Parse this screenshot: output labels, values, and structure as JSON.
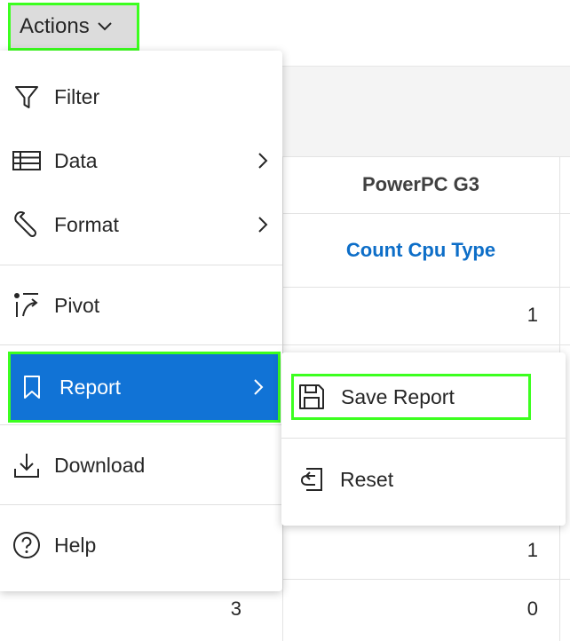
{
  "actions": {
    "label": "Actions"
  },
  "menu": {
    "items": [
      {
        "label": "Filter",
        "icon": "filter-icon"
      },
      {
        "label": "Data",
        "icon": "table-icon",
        "has_submenu": true
      },
      {
        "label": "Format",
        "icon": "wrench-icon",
        "has_submenu": true
      },
      {
        "label": "Pivot",
        "icon": "pivot-icon"
      },
      {
        "label": "Report",
        "icon": "bookmark-icon",
        "has_submenu": true,
        "active": true
      },
      {
        "label": "Download",
        "icon": "download-icon"
      },
      {
        "label": "Help",
        "icon": "help-icon"
      }
    ]
  },
  "submenu": {
    "items": [
      {
        "label": "Save Report",
        "icon": "save-icon"
      },
      {
        "label": "Reset",
        "icon": "reset-icon"
      }
    ]
  },
  "report": {
    "column_header": "PowerPC G3",
    "column_subheader": "Count Cpu Type",
    "values": [
      "1",
      "1",
      "0"
    ],
    "left_value": "3"
  },
  "colors": {
    "accent": "#1173d6",
    "highlight": "#3cff1f",
    "link": "#0d6ec8"
  }
}
